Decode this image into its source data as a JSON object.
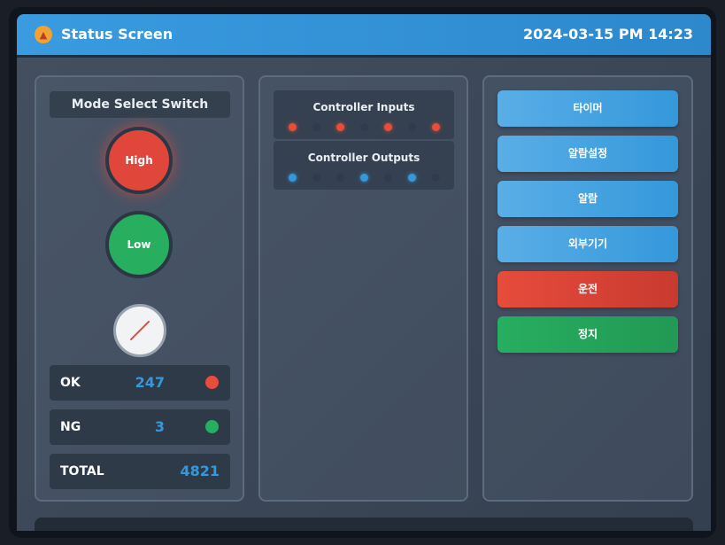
{
  "header": {
    "title": "Status Screen",
    "datetime": "2024-03-15 PM 14:23",
    "logo_icon": "flame-icon"
  },
  "mode_panel": {
    "title": "Mode Select Switch",
    "high_label": "High",
    "low_label": "Low",
    "selector_icon": "rotary-selector-icon",
    "stats": {
      "ok": {
        "label": "OK",
        "value": "247",
        "indicator": "red"
      },
      "ng": {
        "label": "NG",
        "value": "3",
        "indicator": "green"
      },
      "total": {
        "label": "TOTAL",
        "value": "4821"
      }
    }
  },
  "io_panel": {
    "inputs": {
      "label": "Controller Inputs",
      "states": [
        true,
        false,
        true,
        false,
        true,
        false,
        true
      ]
    },
    "outputs": {
      "label": "Controller Outputs",
      "states": [
        true,
        false,
        false,
        true,
        false,
        true,
        false
      ]
    }
  },
  "buttons": [
    {
      "label": "타이머",
      "color": "blue"
    },
    {
      "label": "알람설정",
      "color": "blue"
    },
    {
      "label": "알람",
      "color": "blue"
    },
    {
      "label": "외부기기",
      "color": "blue"
    },
    {
      "label": "운전",
      "color": "red"
    },
    {
      "label": "정지",
      "color": "green"
    }
  ],
  "colors": {
    "accent": "#3498db",
    "high_lamp": "#e74c3c",
    "low_lamp": "#27ae60",
    "input_on": "#e74c3c",
    "output_on": "#3498db"
  }
}
